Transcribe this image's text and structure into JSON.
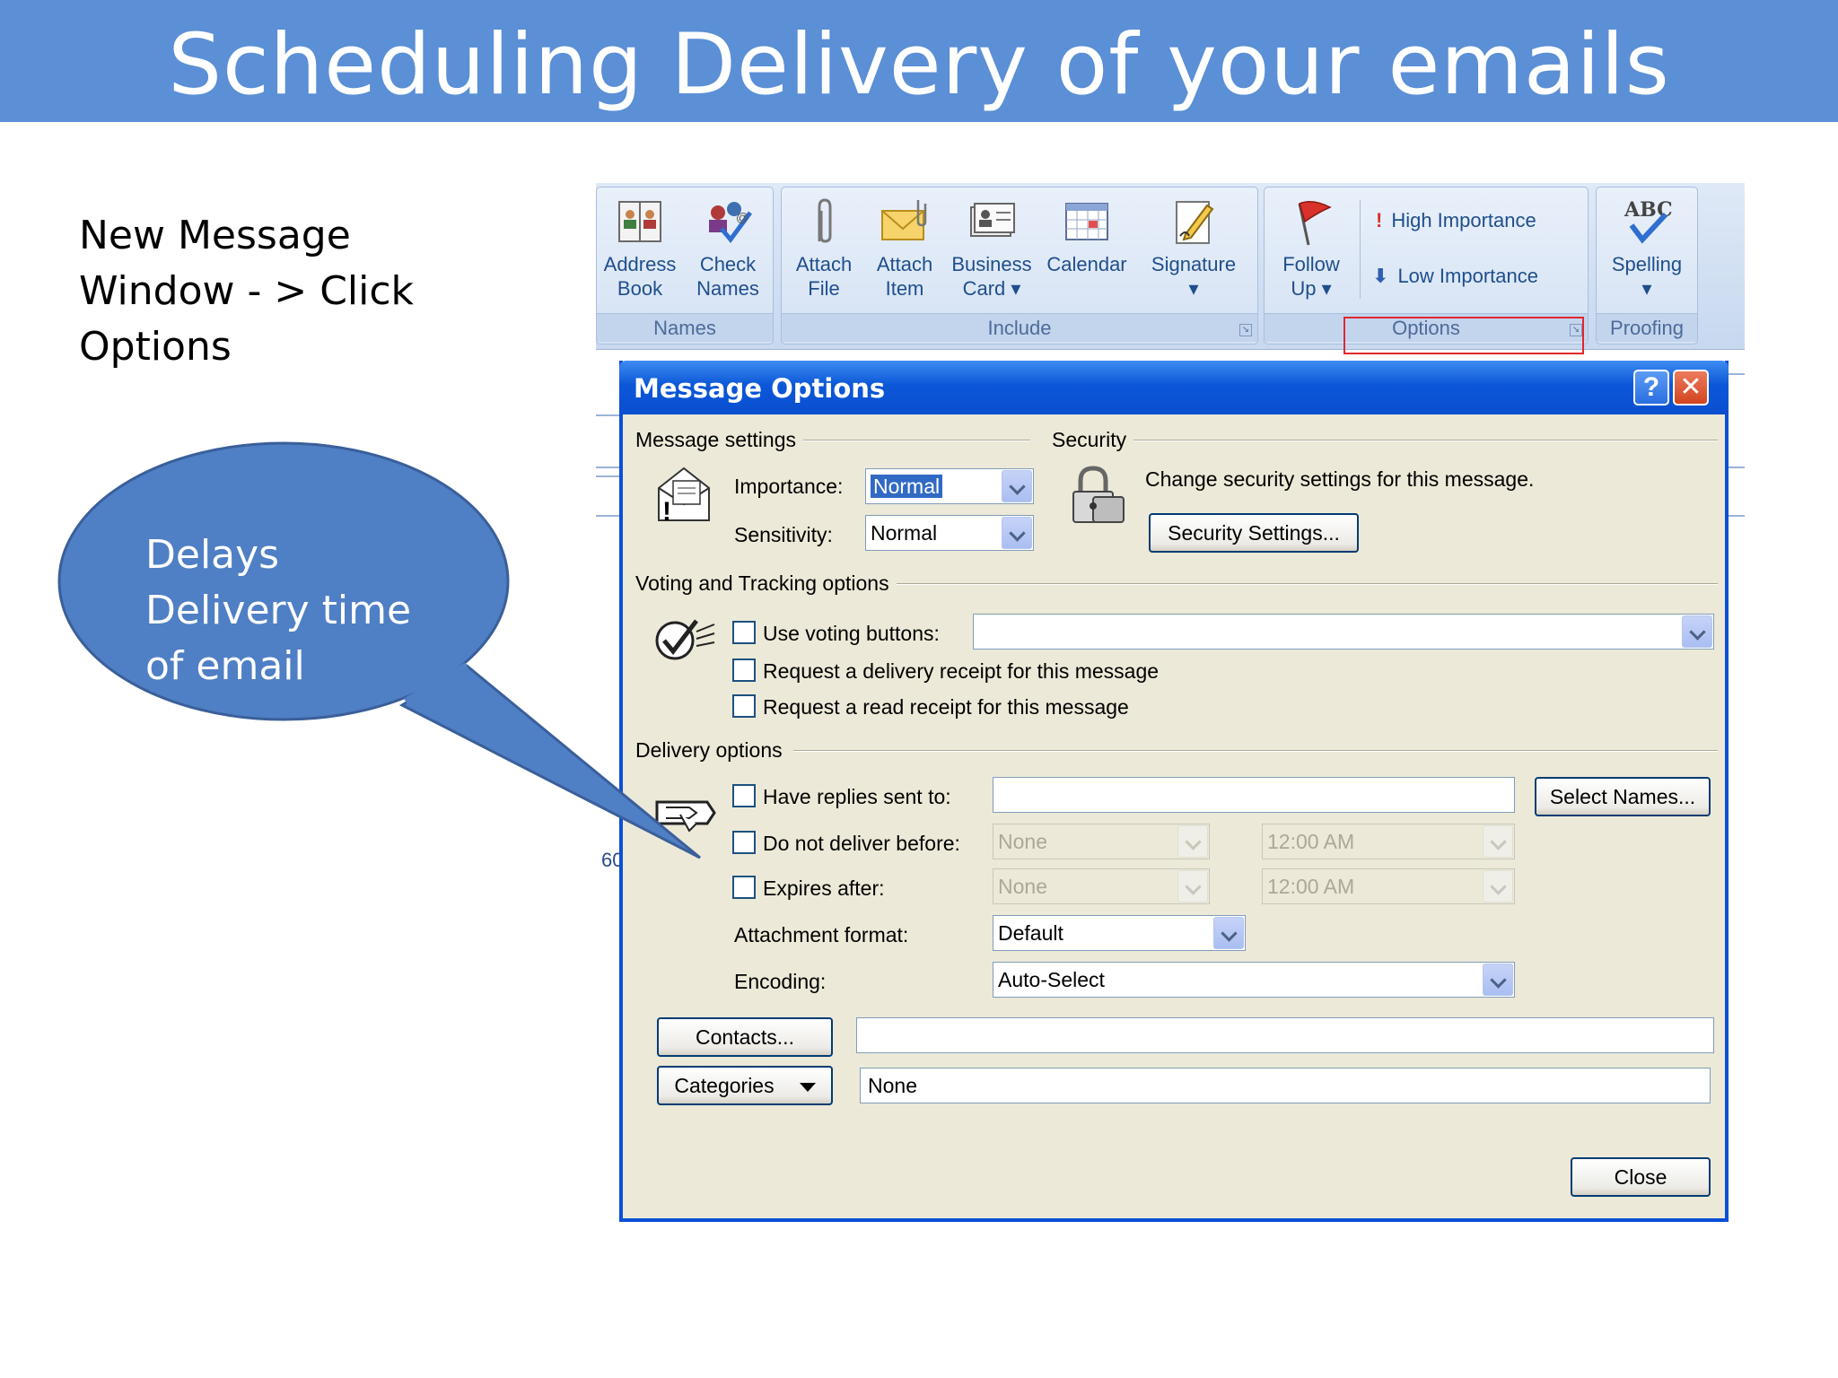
{
  "slide": {
    "title": "Scheduling Delivery of your emails",
    "instruction": [
      "New Message",
      "Window - > Click",
      "Options"
    ],
    "callout": [
      "Delays",
      "Delivery time",
      "of email"
    ],
    "stray_text": "60"
  },
  "ribbon": {
    "groups": [
      {
        "label": "Names",
        "buttons": [
          {
            "label1": "Address",
            "label2": "Book"
          },
          {
            "label1": "Check",
            "label2": "Names"
          }
        ]
      },
      {
        "label": "Include",
        "buttons": [
          {
            "label1": "Attach",
            "label2": "File"
          },
          {
            "label1": "Attach",
            "label2": "Item"
          },
          {
            "label1": "Business",
            "label2": "Card ▾"
          },
          {
            "label1": "Calendar",
            "label2": ""
          },
          {
            "label1": "Signature",
            "label2": "▾"
          }
        ]
      },
      {
        "label": "Options",
        "buttons": [
          {
            "label1": "Follow",
            "label2": "Up ▾"
          }
        ],
        "small": [
          "High Importance",
          "Low Importance"
        ]
      },
      {
        "label": "Proofing",
        "buttons": [
          {
            "label1": "Spelling",
            "label2": "▾"
          }
        ]
      }
    ]
  },
  "dialog": {
    "title": "Message Options",
    "help": "?",
    "close_x": "✕",
    "message_settings": {
      "heading": "Message settings",
      "importance_label": "Importance:",
      "importance_value": "Normal",
      "sensitivity_label": "Sensitivity:",
      "sensitivity_value": "Normal"
    },
    "security": {
      "heading": "Security",
      "text": "Change security settings for this message.",
      "button": "Security Settings..."
    },
    "voting": {
      "heading": "Voting and Tracking options",
      "use_voting": "Use voting buttons:",
      "voting_value": "",
      "delivery_receipt": "Request a delivery receipt for this message",
      "read_receipt": "Request a read receipt for this message"
    },
    "delivery": {
      "heading": "Delivery options",
      "replies_label": "Have replies sent to:",
      "replies_value": "",
      "select_names": "Select Names...",
      "not_before_label": "Do not deliver before:",
      "not_before_date": "None",
      "not_before_time": "12:00 AM",
      "expires_label": "Expires after:",
      "expires_date": "None",
      "expires_time": "12:00 AM",
      "attachment_label": "Attachment format:",
      "attachment_value": "Default",
      "encoding_label": "Encoding:",
      "encoding_value": "Auto-Select"
    },
    "contacts_button": "Contacts...",
    "contacts_value": "",
    "categories_button": "Categories",
    "categories_value": "None",
    "close_button": "Close"
  },
  "colors": {
    "banner": "#5b8fd6",
    "bubble": "#4f7fc4",
    "titlebar": "#0b57d8",
    "highlight": "#e0272f"
  }
}
